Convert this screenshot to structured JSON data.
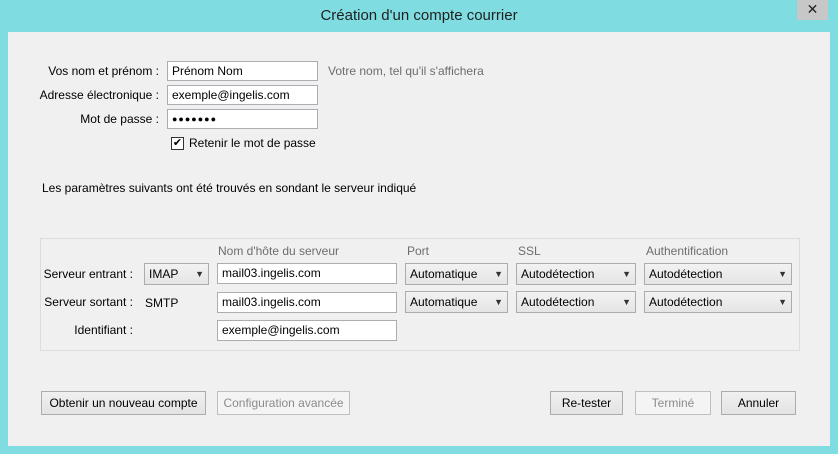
{
  "window": {
    "title": "Création d'un compte courrier",
    "close_glyph": "✕"
  },
  "identity": {
    "name_label": "Vos nom et prénom :",
    "name_value": "Prénom Nom",
    "name_hint": "Votre nom, tel qu'il s'affichera",
    "email_label": "Adresse électronique :",
    "email_value": "exemple@ingelis.com",
    "password_label": "Mot de passe :",
    "password_value": "●●●●●●●",
    "remember_label": "Retenir le mot de passe",
    "remember_checked": true
  },
  "info_text": "Les paramètres suivants ont été trouvés en sondant le serveur indiqué",
  "servers": {
    "headers": {
      "hostname": "Nom d'hôte du serveur",
      "port": "Port",
      "ssl": "SSL",
      "auth": "Authentification"
    },
    "incoming": {
      "label": "Serveur entrant :",
      "protocol": "IMAP",
      "hostname": "mail03.ingelis.com",
      "port": "Automatique",
      "ssl": "Autodétection",
      "auth": "Autodétection"
    },
    "outgoing": {
      "label": "Serveur sortant :",
      "protocol": "SMTP",
      "hostname": "mail03.ingelis.com",
      "port": "Automatique",
      "ssl": "Autodétection",
      "auth": "Autodétection"
    },
    "identifier": {
      "label": "Identifiant :",
      "value": "exemple@ingelis.com"
    }
  },
  "buttons": {
    "new_account": "Obtenir un nouveau compte",
    "advanced": "Configuration avancée",
    "retest": "Re-tester",
    "done": "Terminé",
    "cancel": "Annuler"
  }
}
